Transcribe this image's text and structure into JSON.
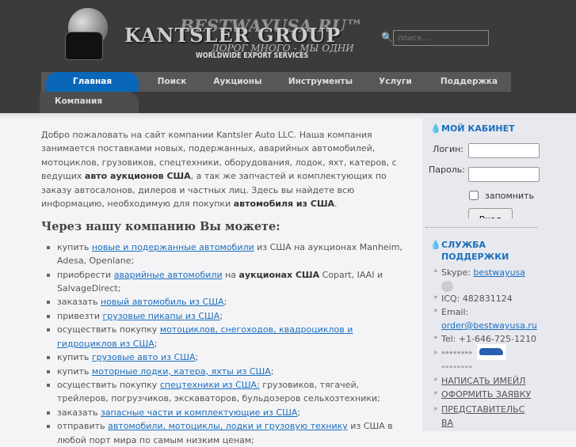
{
  "header": {
    "logo_main": "KANTSLER GROUP",
    "logo_site": "BESTWAYUSA.RU™",
    "logo_slogan": "ДОРОГ МНОГО - МЫ ОДНИ",
    "logo_tagline": "WORLDWIDE EXPORT SERVICES",
    "search_placeholder": "поиск..."
  },
  "nav": {
    "items": [
      "Главная",
      "Поиск",
      "Аукционы",
      "Инструменты",
      "Услуги",
      "Поддержка"
    ],
    "sub": "Компания"
  },
  "main": {
    "intro": [
      {
        "t": "Добро пожаловать на сайт компании Kantsler Auto LLC. Наша компания занимается поставками новых, подержанных, аварийных автомобилей, мотоциклов, грузовиков, спецтехники, оборудования, лодок, яхт, катеров, с ведущих "
      },
      {
        "b": "авто аукционов США"
      },
      {
        "t": ", а так же запчастей и комплектующих по заказу автосалонов, дилеров и частных лиц. Здесь вы найдете всю информацию, необходимую для покупки "
      },
      {
        "b": "автомобиля из США"
      },
      {
        "t": "."
      }
    ],
    "heading": "Через нашу компанию Вы можете:",
    "list": [
      [
        {
          "t": "купить "
        },
        {
          "a": "новые и подержанные автомобили"
        },
        {
          "t": " из США на аукционах Manheim, Adesa, Openlane;"
        }
      ],
      [
        {
          "t": "приобрести "
        },
        {
          "a": "аварийные автомобили"
        },
        {
          "t": " на "
        },
        {
          "b": "аукционах США"
        },
        {
          "t": " Copart, IAAI и SalvageDirect;"
        }
      ],
      [
        {
          "t": "заказать "
        },
        {
          "a": "новый автомобиль из США"
        },
        {
          "t": ";"
        }
      ],
      [
        {
          "t": "привезти "
        },
        {
          "a": "грузовые пикапы из США"
        },
        {
          "t": ";"
        }
      ],
      [
        {
          "t": "осуществить покупку "
        },
        {
          "a": "мотоциклов, снегоходов, квадроциклов и гидроциклов из США"
        },
        {
          "t": ";"
        }
      ],
      [
        {
          "t": "купить "
        },
        {
          "a": "грузовые авто из США"
        },
        {
          "t": ";"
        }
      ],
      [
        {
          "t": "купить "
        },
        {
          "a": "моторные лодки, катера, яхты из США"
        },
        {
          "t": ";"
        }
      ],
      [
        {
          "t": "осуществить покупку "
        },
        {
          "a": "спецтехники из США:"
        },
        {
          "t": " грузовиков, тягачей, трейлеров, погрузчиков, экскаваторов, бульдозеров сельхозтехники;"
        }
      ],
      [
        {
          "t": "заказать "
        },
        {
          "a": "запасные части и комплектующие из США"
        },
        {
          "t": ";"
        }
      ],
      [
        {
          "t": "отправить "
        },
        {
          "a": "автомобили, мотоциклы, лодки и грузовую технику"
        },
        {
          "t": " из США в любой порт мира по самым низким ценам;"
        }
      ]
    ]
  },
  "sidebar": {
    "cabinet_title": "МОЙ КАБИНЕТ",
    "login_label": "Логин:",
    "password_label": "Пароль:",
    "remember_label": "запомнить",
    "login_button": "Вход",
    "support_title": "СЛУЖБА ПОДДЕРЖКИ",
    "skype_label": "Skype:",
    "skype_link": "bestwayusa",
    "icq": "ICQ: 482831124",
    "email_label": "Email:",
    "email_link": "order@bestwayusa.ru",
    "tel": "Tel: +1-646-725-1210",
    "arrows_right": "»»»»»»»»",
    "arrows_left": "««««««««",
    "links": [
      "НАПИСАТЬ ИМЕЙЛ",
      "ОФОРМИТЬ ЗАЯВКУ",
      "ПРЕДСТАВИТЕЛЬСВА"
    ]
  },
  "colors": {
    "accent": "#0a66b8",
    "link": "#1a6fc0",
    "header_bg": "#3b3b3b"
  }
}
